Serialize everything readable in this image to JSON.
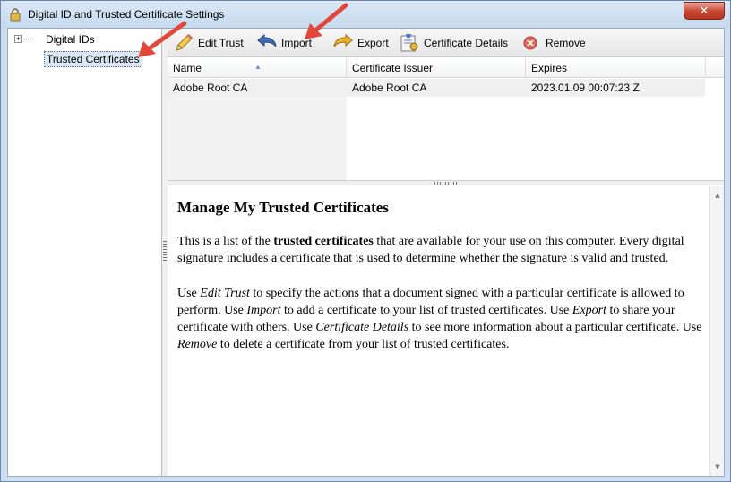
{
  "window": {
    "title": "Digital ID and Trusted Certificate Settings",
    "close_glyph": "✕"
  },
  "tree": {
    "expander": "+",
    "items": [
      {
        "label": "Digital IDs"
      },
      {
        "label": "Trusted Certificates",
        "selected": true
      }
    ]
  },
  "toolbar": {
    "edit_trust": "Edit Trust",
    "import": "Import",
    "export": "Export",
    "certificate_details": "Certificate Details",
    "remove": "Remove"
  },
  "table": {
    "columns": [
      "Name",
      "Certificate Issuer",
      "Expires"
    ],
    "sort_indicator": "▲",
    "rows": [
      {
        "name": "Adobe Root CA",
        "issuer": "Adobe Root CA",
        "expires": "2023.01.09 00:07:23 Z"
      }
    ]
  },
  "help": {
    "title": "Manage My Trusted Certificates",
    "p1_a": "This is a list of the ",
    "p1_b": "trusted certificates",
    "p1_c": " that are available for your use on this computer. Every digital signature includes a certificate that is used to determine whether the signature is valid and trusted.",
    "p2_a": "Use ",
    "p2_b": "Edit Trust",
    "p2_c": " to specify the actions that a document signed with a particular certificate is allowed to perform. Use ",
    "p2_d": "Import",
    "p2_e": " to add a certificate to your list of trusted certificates. Use ",
    "p2_f": "Export",
    "p2_g": " to share your certificate with others. Use ",
    "p2_h": "Certificate Details",
    "p2_i": " to see more information about a particular certificate. Use ",
    "p2_j": "Remove",
    "p2_k": " to delete a certificate from your list of trusted certificates."
  },
  "scrollbar": {
    "up": "▲",
    "down": "▼"
  },
  "colors": {
    "annotation_arrow": "#e2483a",
    "selection": "#dbe7f5",
    "row_bg": "#f0f0f0"
  },
  "icons": [
    "lock-icon",
    "pencil-icon",
    "import-arrow-icon",
    "export-arrow-icon",
    "certificate-details-icon",
    "remove-icon"
  ]
}
